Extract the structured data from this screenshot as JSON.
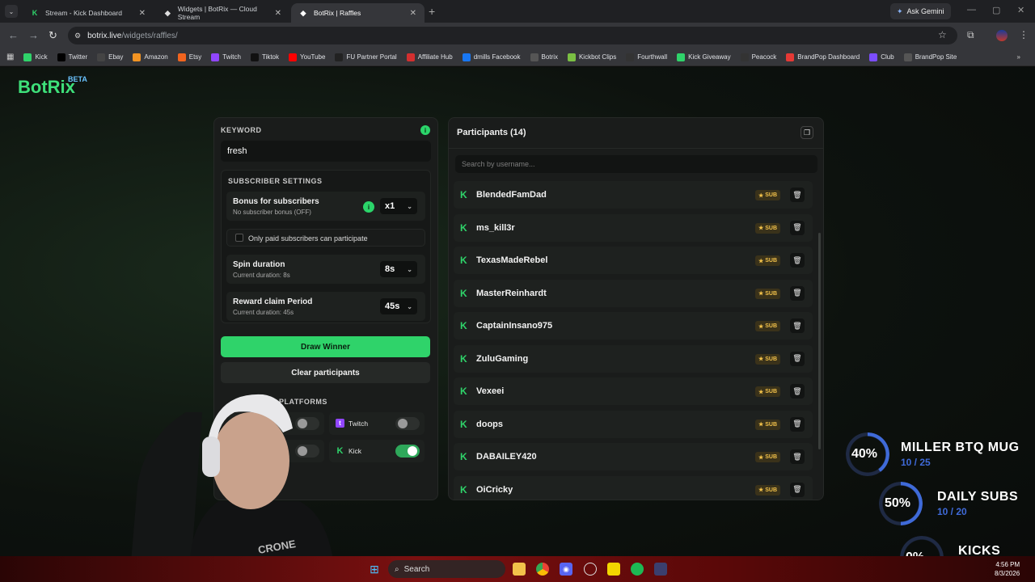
{
  "browser": {
    "tabs": [
      {
        "title": "Stream - Kick Dashboard",
        "icon": "kick-icon",
        "active": false
      },
      {
        "title": "Widgets | BotRix — Cloud Stream",
        "icon": "botrix-icon",
        "active": false
      },
      {
        "title": "BotRix | Raffles",
        "icon": "botrix-icon",
        "active": true
      }
    ],
    "ask_gemini": "Ask Gemini",
    "url_host": "botrix.live",
    "url_path": "/widgets/raffles/",
    "bookmarks": [
      {
        "label": "Kick",
        "icon": "kick-icon",
        "color": "#2fd36a"
      },
      {
        "label": "Twitter",
        "icon": "x-icon",
        "color": "#000000"
      },
      {
        "label": "Ebay",
        "icon": "ebay-icon",
        "color": "#444444"
      },
      {
        "label": "Amazon",
        "icon": "amazon-icon",
        "color": "#f29423"
      },
      {
        "label": "Etsy",
        "icon": "etsy-icon",
        "color": "#f1641e"
      },
      {
        "label": "Twitch",
        "icon": "twitch-icon",
        "color": "#9146ff"
      },
      {
        "label": "Tiktok",
        "icon": "tiktok-icon",
        "color": "#111111"
      },
      {
        "label": "YouTube",
        "icon": "youtube-icon",
        "color": "#ff0000"
      },
      {
        "label": "FU Partner Portal",
        "icon": "portal-icon",
        "color": "#222222"
      },
      {
        "label": "Affiliate Hub",
        "icon": "affiliate-icon",
        "color": "#d32f2f"
      },
      {
        "label": "dmills Facebook",
        "icon": "facebook-icon",
        "color": "#1877f2"
      },
      {
        "label": "Botrix",
        "icon": "botrix-icon",
        "color": "#555555"
      },
      {
        "label": "Kickbot Clips",
        "icon": "kickbot-icon",
        "color": "#7bc043"
      },
      {
        "label": "Fourthwall",
        "icon": "fourthwall-icon",
        "color": "#333333"
      },
      {
        "label": "Kick Giveaway",
        "icon": "kick-icon",
        "color": "#2fd36a"
      },
      {
        "label": "Peacock",
        "icon": "peacock-icon",
        "color": "#333333"
      },
      {
        "label": "BrandPop Dashboard",
        "icon": "brandpop-icon",
        "color": "#e53935"
      },
      {
        "label": "Club",
        "icon": "club-icon",
        "color": "#7c4dff"
      },
      {
        "label": "BrandPop Site",
        "icon": "globe-icon",
        "color": "#555555"
      }
    ]
  },
  "app": {
    "logo": "BotRix",
    "logo_badge": "BETA"
  },
  "settings": {
    "keyword_label": "KEYWORD",
    "keyword_value": "fresh",
    "subscriber_title": "SUBSCRIBER SETTINGS",
    "bonus_title": "Bonus for subscribers",
    "bonus_sub": "No subscriber bonus (OFF)",
    "bonus_value": "x1",
    "paid_only_label": "Only paid subscribers can participate",
    "spin_title": "Spin duration",
    "spin_sub": "Current duration: 8s",
    "spin_value": "8s",
    "claim_title": "Reward claim Period",
    "claim_sub": "Current duration: 45s",
    "claim_value": "45s",
    "draw_button": "Draw Winner",
    "clear_button": "Clear participants",
    "platforms_title": "PLATFORMS",
    "platforms": [
      {
        "label": "",
        "enabled": false
      },
      {
        "label": "Twitch",
        "enabled": false
      },
      {
        "label": "be",
        "enabled": false
      },
      {
        "label": "Kick",
        "enabled": true
      }
    ]
  },
  "participants": {
    "title": "Participants (14)",
    "search_placeholder": "Search by username...",
    "badge_label": "SUB",
    "list": [
      "BlendedFamDad",
      "ms_kill3r",
      "TexasMadeRebel",
      "MasterReinhardt",
      "CaptainInsano975",
      "ZuluGaming",
      "Vexeei",
      "doops",
      "DABAILEY420",
      "OiCricky"
    ]
  },
  "goals": [
    {
      "pct": "40%",
      "name": "MILLER BTQ MUG",
      "count": "10 / 25",
      "progress": 0.4
    },
    {
      "pct": "50%",
      "name": "DAILY SUBS",
      "count": "10 / 20",
      "progress": 0.5
    },
    {
      "pct": "0%",
      "name": "KICKS",
      "count": "0 / 10000",
      "progress": 0.0
    }
  ],
  "taskbar": {
    "search_label": "Search",
    "time": "4:56 PM",
    "date": "8/3/2026"
  },
  "colors": {
    "accent_green": "#2fd36a",
    "badge_gold": "#f3c24a",
    "goal_blue": "#3f6ad8"
  }
}
